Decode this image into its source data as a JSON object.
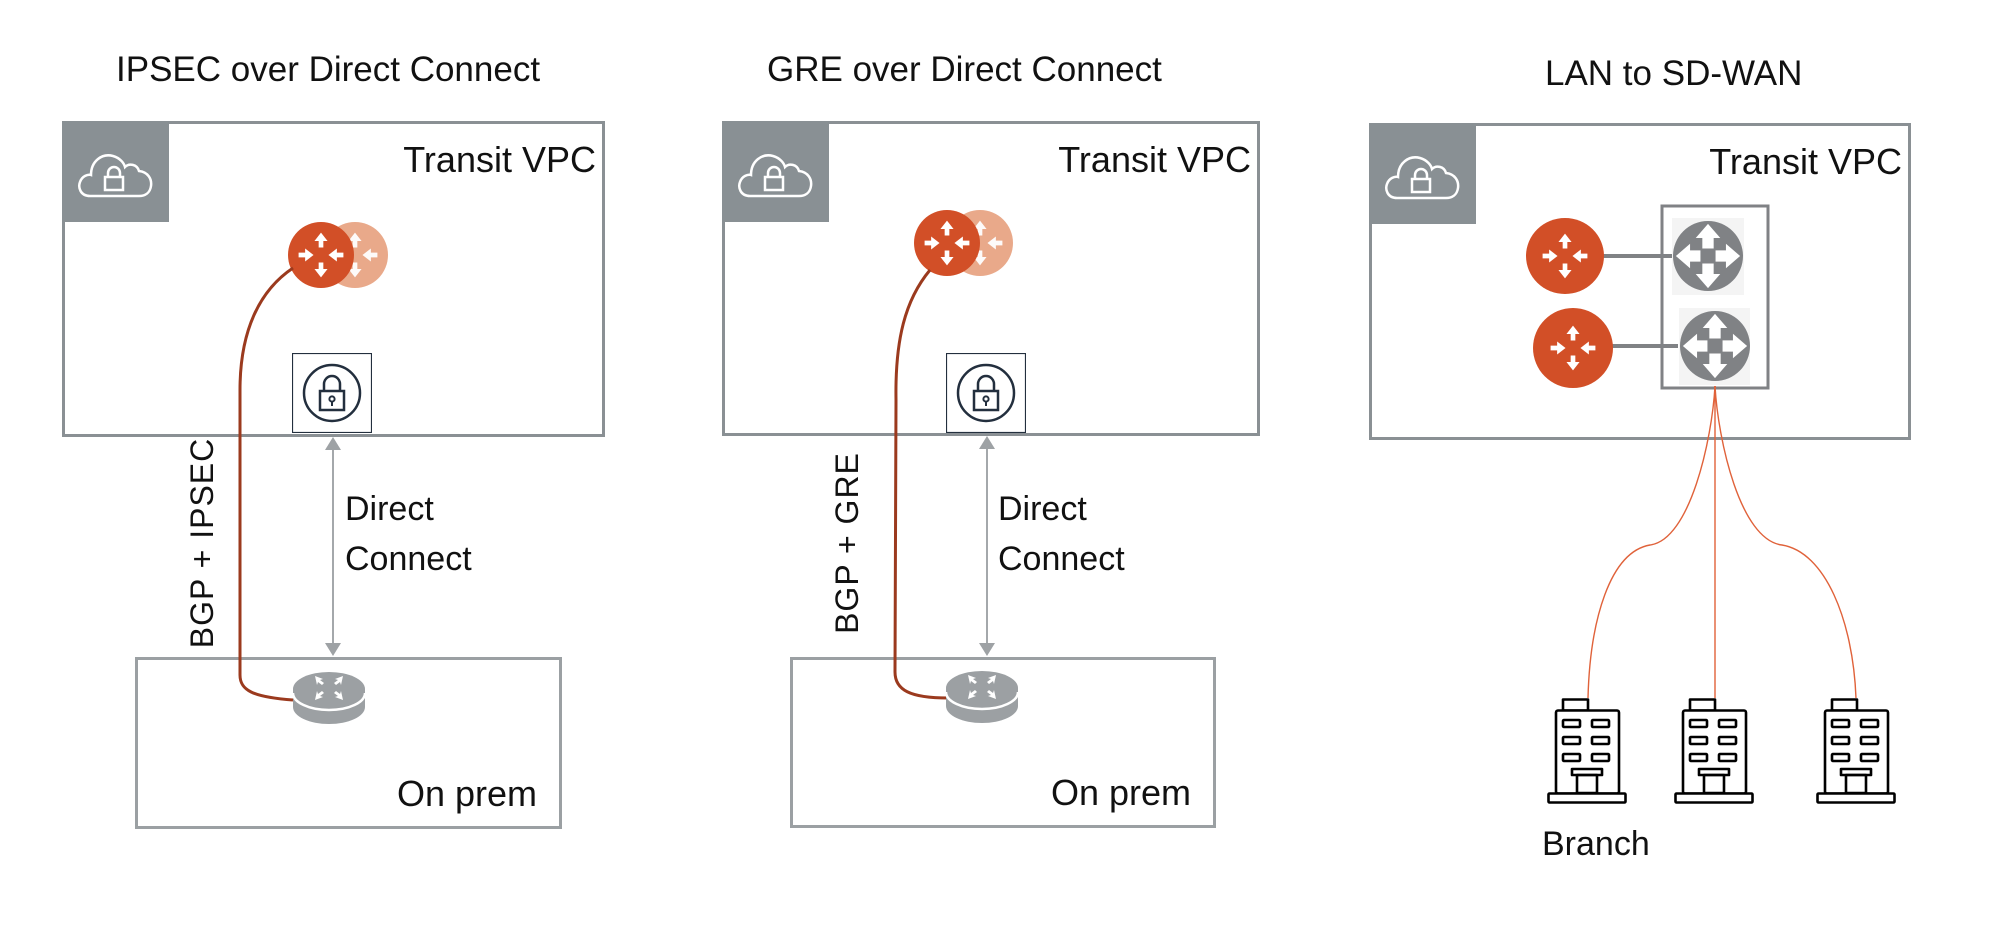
{
  "panels": [
    {
      "title": "IPSEC over Direct Connect",
      "vpc_label": "Transit VPC",
      "tunnel_label": "BGP + IPSEC",
      "link_label_line1": "Direct",
      "link_label_line2": "Connect",
      "onprem_label": "On prem"
    },
    {
      "title": "GRE over Direct Connect",
      "vpc_label": "Transit VPC",
      "tunnel_label": "BGP + GRE",
      "link_label_line1": "Direct",
      "link_label_line2": "Connect",
      "onprem_label": "On prem"
    },
    {
      "title": "LAN to SD-WAN",
      "vpc_label": "Transit VPC",
      "branch_label": "Branch",
      "branch_count": 3
    }
  ],
  "colors": {
    "router_orange": "#d24f27",
    "router_orange_faded": "#e9a98a",
    "tunnel_line": "#9b3a1e",
    "sdwan_line": "#e0623a",
    "box_border": "#8a9094",
    "cloud_tile": "#899094",
    "gray_router": "#808285",
    "lock_icon": "#232f3e"
  }
}
